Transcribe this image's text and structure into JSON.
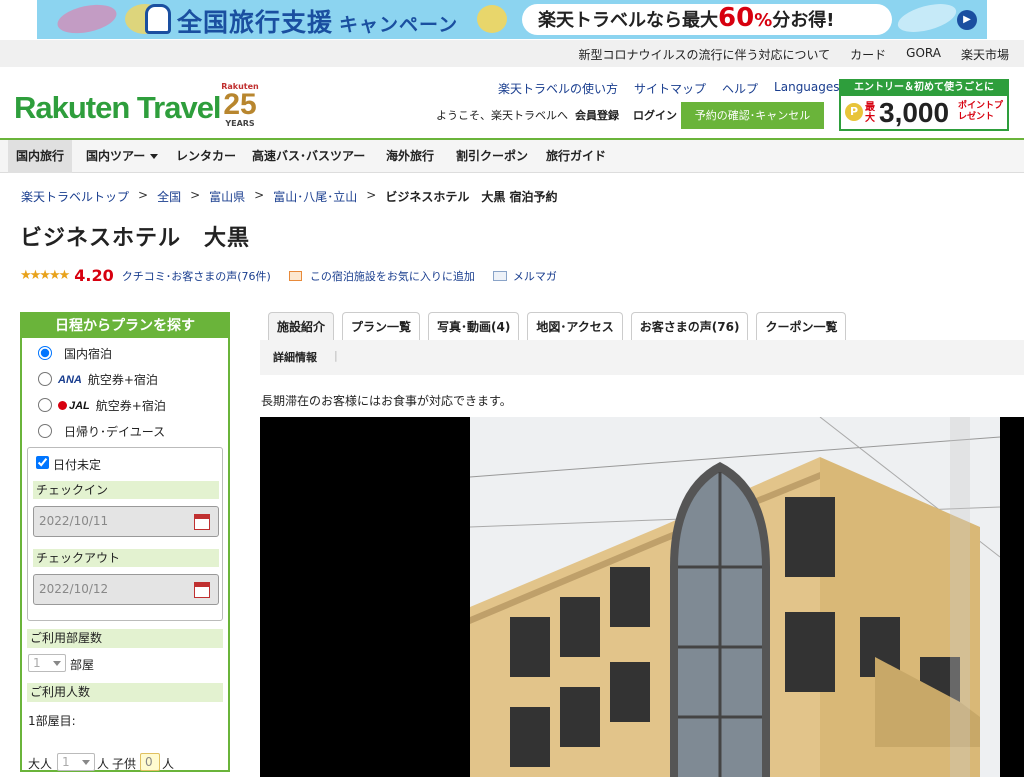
{
  "banner": {
    "title": "全国旅行支援",
    "campaign": "キャンペーン",
    "pill_prefix": "楽天トラベルなら最大",
    "pill_percent": "60",
    "pill_pct_sign": "%",
    "pill_suffix": "分お得!"
  },
  "topbar": {
    "links": [
      "新型コロナウイルスの流行に伴う対応について",
      "カード",
      "GORA",
      "楽天市場"
    ]
  },
  "logo": {
    "text": "Rakuten Travel",
    "anniv_brand": "Rakuten",
    "anniv_number": "25",
    "anniv_years": "YEARS"
  },
  "header": {
    "links": [
      "楽天トラベルの使い方",
      "サイトマップ",
      "ヘルプ"
    ],
    "languages": "Languages",
    "welcome": "ようこそ、楽天トラベルへ",
    "signup": "会員登録",
    "login": "ログイン",
    "reserve_button": "予約の確認･キャンセル"
  },
  "promo": {
    "top": "エントリー＆初めて使うごとに",
    "coin": "P",
    "max": "最大",
    "amount": "3,000",
    "points": "ポイントプレゼント"
  },
  "nav": {
    "items": [
      "国内旅行",
      "国内ツアー",
      "レンタカー",
      "高速バス･バスツアー",
      "海外旅行",
      "割引クーポン",
      "旅行ガイド"
    ]
  },
  "breadcrumb": {
    "items": [
      "楽天トラベルトップ",
      "全国",
      "富山県",
      "富山･八尾･立山"
    ],
    "separator": ">",
    "current": "ビジネスホテル　大黒 宿泊予約"
  },
  "hotel": {
    "title": "ビジネスホテル　大黒",
    "stars": "★★★★★",
    "score": "4.20",
    "reviews": "クチコミ･お客さまの声(76件)",
    "favorite": "この宿泊施設をお気に入りに追加",
    "mailmag": "メルマガ",
    "description": "長期滞在のお客様にはお食事が対応できます。"
  },
  "search": {
    "heading": "日程からプランを探す",
    "options": [
      "国内宿泊",
      "航空券+宿泊",
      "航空券+宿泊",
      "日帰り･デイユース"
    ],
    "ana": "ANA",
    "jal": "JAL",
    "undecided": "日付未定",
    "checkin_label": "チェックイン",
    "checkin_value": "2022/10/11",
    "checkout_label": "チェックアウト",
    "checkout_value": "2022/10/12",
    "rooms_label": "ご利用部屋数",
    "rooms_value": "1",
    "rooms_unit": "部屋",
    "guests_label": "ご利用人数",
    "room1": "1部屋目:",
    "adult_label": "大人",
    "adult_value": "1",
    "adult_unit": "人",
    "child_label": "子供",
    "child_value": "0",
    "child_unit": "人"
  },
  "tabs": {
    "items": [
      "施設紹介",
      "プラン一覧",
      "写真･動画(4)",
      "地図･アクセス",
      "お客さまの声(76)",
      "クーポン一覧"
    ],
    "sub": "詳細情報",
    "pipe": "|"
  },
  "colors": {
    "green": "#6ab43a",
    "red": "#d7000f",
    "link": "#1a3e8f"
  }
}
